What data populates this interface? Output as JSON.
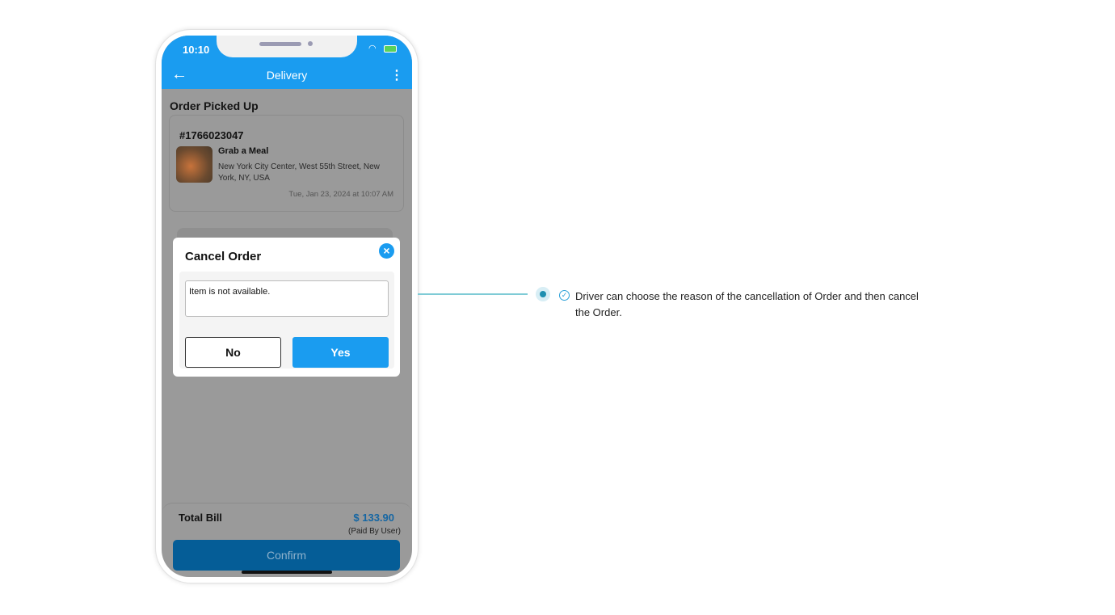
{
  "status": {
    "time": "10:10"
  },
  "header": {
    "title": "Delivery"
  },
  "section_title": "Order Picked Up",
  "order": {
    "id": "#1766023047",
    "restaurant": "Grab a Meal",
    "address": "New York City Center, West 55th Street, New York, NY, USA",
    "datetime": "Tue, Jan 23, 2024 at 10:07 AM"
  },
  "modal": {
    "title": "Cancel Order",
    "reason_value": "Item is not available.",
    "no_label": "No",
    "yes_label": "Yes"
  },
  "footer": {
    "total_label": "Total Bill",
    "total_value": "$ 133.90",
    "paid_note": "(Paid By User)",
    "confirm_label": "Confirm"
  },
  "annotation": {
    "text": "Driver can choose the reason of the cancellation of Order and then cancel the Order."
  },
  "colors": {
    "accent": "#1a9cf0",
    "annotation_line": "#7fcbd6"
  }
}
